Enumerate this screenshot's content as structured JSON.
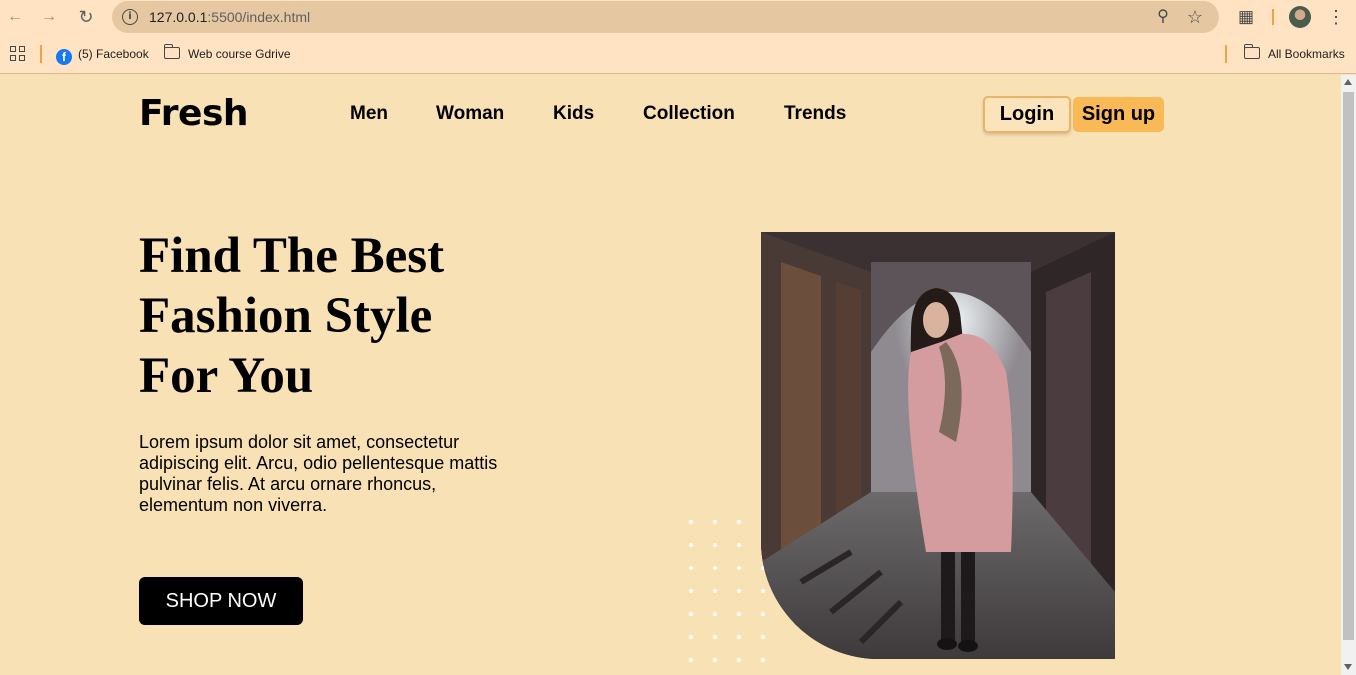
{
  "browser": {
    "url_host": "127.0.0.1",
    "url_path": ":5500/index.html",
    "back_icon": "arrow-left-icon",
    "forward_icon": "arrow-right-icon",
    "reload_icon": "reload-icon",
    "bookmarks": {
      "facebook_label": "(5) Facebook",
      "folder_label": "Web course Gdrive",
      "all_bookmarks_label": "All Bookmarks"
    }
  },
  "site": {
    "logo": "Fresh",
    "nav": {
      "men": "Men",
      "woman": "Woman",
      "kids": "Kids",
      "collection": "Collection",
      "trends": "Trends"
    },
    "login_label": "Login",
    "signup_label": "Sign up",
    "hero": {
      "title_line1": "Find The Best",
      "title_line2": "Fashion Style",
      "title_line3": "For You",
      "description": "Lorem ipsum dolor sit amet, consectetur adipiscing elit. Arcu, odio pellentesque mattis pulvinar felis. At arcu ornare rhoncus, elementum non viverra.",
      "cta_label": "SHOP NOW"
    }
  },
  "colors": {
    "page_background": "#f9e1b6",
    "accent": "#f9b957",
    "cta_background": "#000000"
  }
}
